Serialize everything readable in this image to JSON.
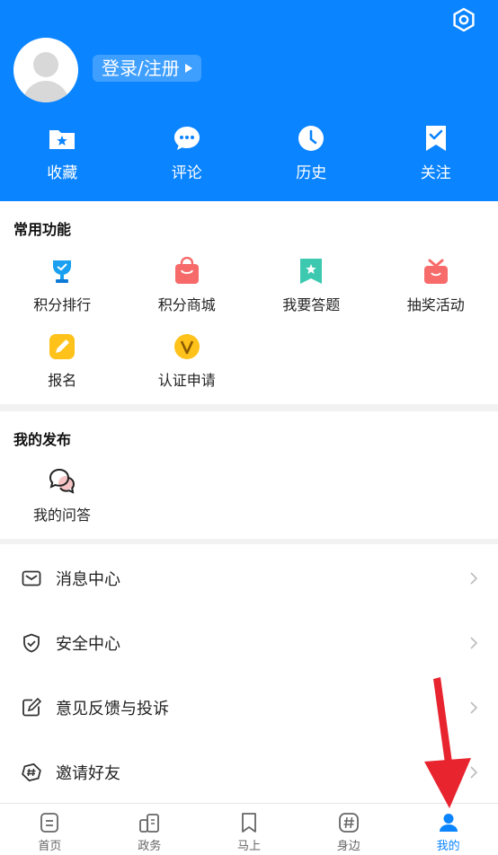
{
  "header": {
    "login_label": "登录/注册",
    "quick_actions": [
      {
        "label": "收藏",
        "icon": "folder-star-icon"
      },
      {
        "label": "评论",
        "icon": "chat-bubble-icon"
      },
      {
        "label": "历史",
        "icon": "clock-icon"
      },
      {
        "label": "关注",
        "icon": "bookmark-check-icon"
      }
    ]
  },
  "common": {
    "title": "常用功能",
    "items": [
      {
        "label": "积分排行",
        "icon": "trophy-icon"
      },
      {
        "label": "积分商城",
        "icon": "shopping-bag-icon"
      },
      {
        "label": "我要答题",
        "icon": "bookmark-star-icon"
      },
      {
        "label": "抽奖活动",
        "icon": "gift-icon"
      },
      {
        "label": "报名",
        "icon": "pencil-icon"
      },
      {
        "label": "认证申请",
        "icon": "verified-v-icon"
      }
    ]
  },
  "publish": {
    "title": "我的发布",
    "items": [
      {
        "label": "我的问答",
        "icon": "qa-bubbles-icon"
      }
    ]
  },
  "menu": {
    "items": [
      {
        "label": "消息中心",
        "icon": "mail-icon"
      },
      {
        "label": "安全中心",
        "icon": "shield-check-icon"
      },
      {
        "label": "意见反馈与投诉",
        "icon": "edit-square-icon"
      },
      {
        "label": "邀请好友",
        "icon": "hashtag-badge-icon"
      }
    ]
  },
  "tabbar": {
    "tabs": [
      {
        "label": "首页",
        "icon": "home-doc-icon",
        "active": false
      },
      {
        "label": "政务",
        "icon": "government-icon",
        "active": false
      },
      {
        "label": "马上",
        "icon": "bookmark-icon",
        "active": false
      },
      {
        "label": "身边",
        "icon": "hashtag-icon",
        "active": false
      },
      {
        "label": "我的",
        "icon": "person-icon",
        "active": true
      }
    ]
  },
  "colors": {
    "brand": "#0a84ff",
    "arrow": "#e8242f"
  }
}
